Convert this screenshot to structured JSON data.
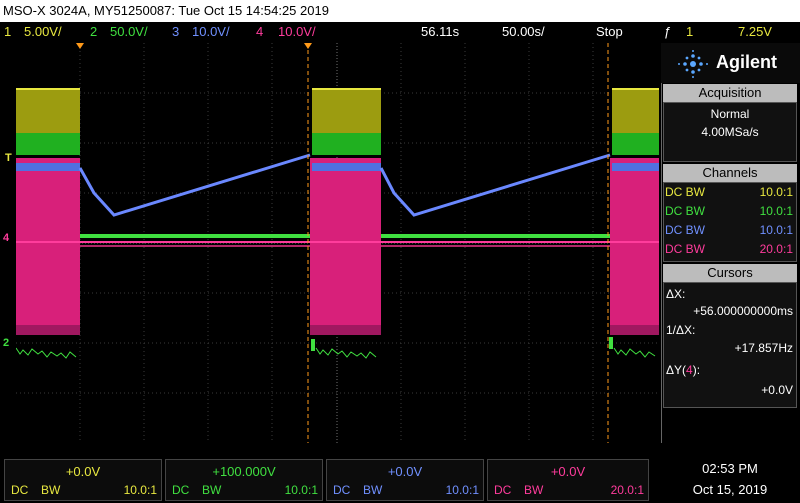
{
  "title_bar": {
    "text": "MSO-X 3024A, MY51250087: Tue Oct 15 14:54:25 2019"
  },
  "channel_bar": {
    "ch1": {
      "num": "1",
      "scale": "5.00V/"
    },
    "ch2": {
      "num": "2",
      "scale": "50.0V/"
    },
    "ch3": {
      "num": "3",
      "scale": "10.0V/"
    },
    "ch4": {
      "num": "4",
      "scale": "10.0V/"
    },
    "delay": "56.11s",
    "timebase": "50.00s/",
    "run_state": "Stop",
    "trigger": {
      "symbol": "ƒ",
      "source": "1",
      "level": "7.25V"
    }
  },
  "brand": {
    "name": "Agilent"
  },
  "acquisition": {
    "header": "Acquisition",
    "mode": "Normal",
    "rate": "4.00MSa/s"
  },
  "channels": {
    "header": "Channels",
    "rows": [
      {
        "coupling": "DC BW",
        "probe": "10.0:1",
        "color": "#e8e840"
      },
      {
        "coupling": "DC BW",
        "probe": "10.0:1",
        "color": "#40e040"
      },
      {
        "coupling": "DC BW",
        "probe": "10.0:1",
        "color": "#7090ff"
      },
      {
        "coupling": "DC BW",
        "probe": "20.0:1",
        "color": "#ff3c9c"
      }
    ]
  },
  "cursors": {
    "header": "Cursors",
    "dx_label": "ΔX:",
    "dx_value": "+56.000000000ms",
    "inv_dx_label": "1/ΔX:",
    "inv_dx_value": "+17.857Hz",
    "dy_label_pre": "ΔY(",
    "dy_channel": "4",
    "dy_label_post": "):",
    "dy_value": "+0.0V"
  },
  "bottom_channels": [
    {
      "offset": "+0.0V",
      "coupling": "DC",
      "bw": "BW",
      "probe": "10.0:1",
      "color": "#e8e840"
    },
    {
      "offset": "+100.000V",
      "coupling": "DC",
      "bw": "BW",
      "probe": "10.0:1",
      "color": "#40e040"
    },
    {
      "offset": "+0.0V",
      "coupling": "DC",
      "bw": "BW",
      "probe": "10.0:1",
      "color": "#7090ff"
    },
    {
      "offset": "+0.0V",
      "coupling": "DC",
      "bw": "BW",
      "probe": "20.0:1",
      "color": "#ff3c9c"
    }
  ],
  "clock": {
    "time": "02:53 PM",
    "date": "Oct 15, 2019"
  },
  "markers": {
    "trigger_level": "T",
    "ch1": "1",
    "ch2": "2",
    "ch4": "4"
  },
  "colors": {
    "ch1": "#e8e840",
    "ch2": "#40e040",
    "ch3": "#7090ff",
    "ch4": "#ff3c9c",
    "cursor": "#ff9a1a"
  }
}
